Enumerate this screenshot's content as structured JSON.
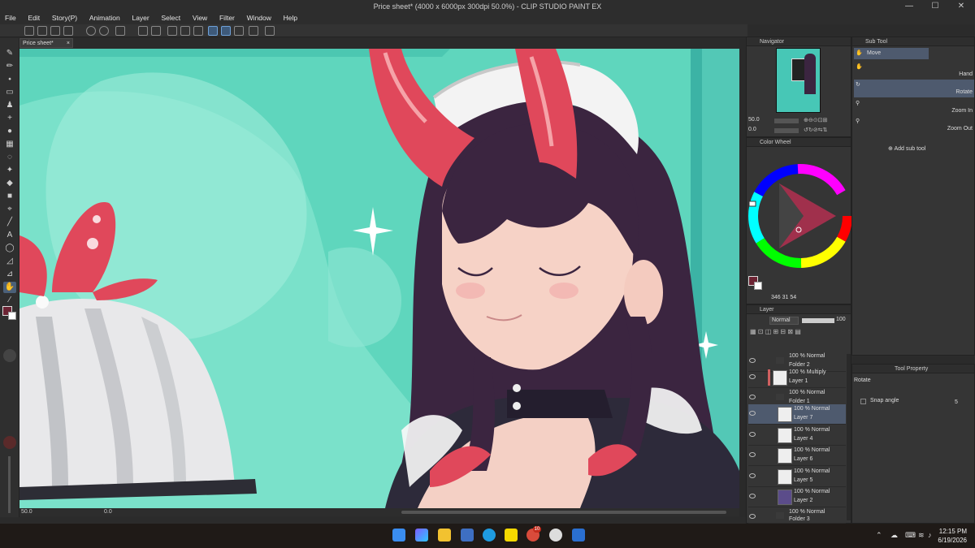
{
  "window": {
    "title": "Price sheet* (4000 x 6000px 300dpi 50.0%) - CLIP STUDIO PAINT EX",
    "minimize": "—",
    "maximize": "☐",
    "close": "✕"
  },
  "menu": [
    "File",
    "Edit",
    "Story(P)",
    "Animation",
    "Layer",
    "Select",
    "View",
    "Filter",
    "Window",
    "Help"
  ],
  "canvas_tab": {
    "label": "Price sheet*",
    "close": "×"
  },
  "canvas_status": {
    "zoom": "50.0",
    "angle": "0.0"
  },
  "navigator": {
    "title": "Navigator",
    "zoom": "50.0",
    "rotation": "0.0"
  },
  "color_wheel": {
    "title": "Color Wheel",
    "h": "346",
    "s": "31",
    "v": "54",
    "main_color": "#6d2434",
    "sub_color": "#ffffff"
  },
  "sub_tool": {
    "title": "Sub Tool",
    "items": [
      {
        "label": "Move",
        "icon": "hand-icon"
      },
      {
        "label": "Hand",
        "icon": "hand-icon"
      },
      {
        "label": "Rotate",
        "icon": "rotate-icon"
      },
      {
        "label": "Zoom In",
        "icon": "magnifier-icon"
      },
      {
        "label": "Zoom Out",
        "icon": "magnifier-icon"
      }
    ],
    "add_label": "Add sub tool"
  },
  "tool_property": {
    "title": "Tool Property",
    "tool_name": "Rotate",
    "snap_label": "Snap angle",
    "snap_value": "5"
  },
  "layer_panel": {
    "title": "Layer",
    "blend_mode": "Normal",
    "opacity": "100",
    "layers": [
      {
        "mode": "100 % Normal",
        "name": "Folder 2",
        "type": "folder"
      },
      {
        "mode": "100 % Multiply",
        "name": "Layer 1",
        "type": "layer"
      },
      {
        "mode": "100 % Normal",
        "name": "Folder 1",
        "type": "folder"
      },
      {
        "mode": "100 % Normal",
        "name": "Layer 7",
        "type": "layer",
        "selected": true
      },
      {
        "mode": "100 % Normal",
        "name": "Layer 4",
        "type": "layer"
      },
      {
        "mode": "100 % Normal",
        "name": "Layer 6",
        "type": "layer"
      },
      {
        "mode": "100 % Normal",
        "name": "Layer 5",
        "type": "layer"
      },
      {
        "mode": "100 % Normal",
        "name": "Layer 2",
        "type": "layer"
      },
      {
        "mode": "100 % Normal",
        "name": "Folder 3",
        "type": "folder"
      }
    ]
  },
  "taskbar": {
    "time": "12:15 PM",
    "date": "6/19/2026",
    "chrome_badge": "10"
  },
  "colors": {
    "canvas_teal": "#5fd6bd",
    "horn_red": "#e0485b",
    "selected_panel": "#4e5a6e"
  }
}
